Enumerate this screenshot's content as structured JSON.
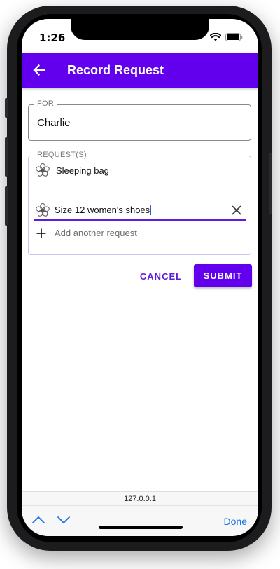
{
  "status_bar": {
    "time": "1:26"
  },
  "app_bar": {
    "title": "Record Request"
  },
  "for_field": {
    "legend": "FOR",
    "value": "Charlie"
  },
  "requests_field": {
    "legend": "REQUEST(S)",
    "items": [
      {
        "label": "Sleeping bag",
        "icon": "flower-icon"
      }
    ],
    "editing_value": "Size 12 women's shoes",
    "add_label": "Add another request"
  },
  "actions": {
    "cancel_label": "CANCEL",
    "submit_label": "SUBMIT"
  },
  "browser": {
    "url": "127.0.0.1",
    "done_label": "Done"
  },
  "colors": {
    "primary": "#6200ee",
    "accent": "#5a1ee0",
    "ios_blue": "#1a73e8"
  }
}
